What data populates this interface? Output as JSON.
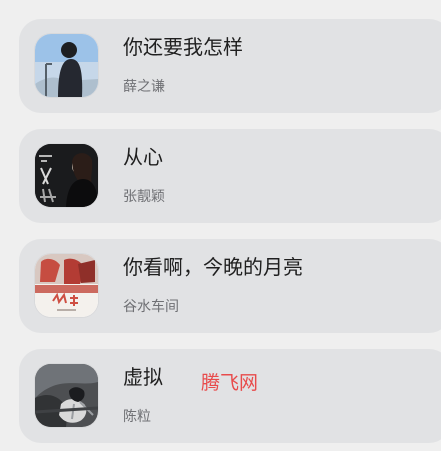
{
  "songs": [
    {
      "title": "你还要我怎样",
      "artist": "薛之谦",
      "cover_icon": "album-cover-singer-portrait"
    },
    {
      "title": "从心",
      "artist": "张靓颖",
      "cover_icon": "album-cover-dark-portrait"
    },
    {
      "title": "你看啊，今晚的月亮",
      "artist": "谷水车间",
      "cover_icon": "album-cover-red-illustration"
    },
    {
      "title": "虚拟",
      "artist": "陈粒",
      "cover_icon": "album-cover-photo"
    }
  ],
  "watermark": "腾飞网",
  "colors": {
    "background": "#efefef",
    "card": "#e1e2e4",
    "title_text": "#1f1f1f",
    "artist_text": "#6f7074",
    "watermark_text": "#e84b4b"
  }
}
